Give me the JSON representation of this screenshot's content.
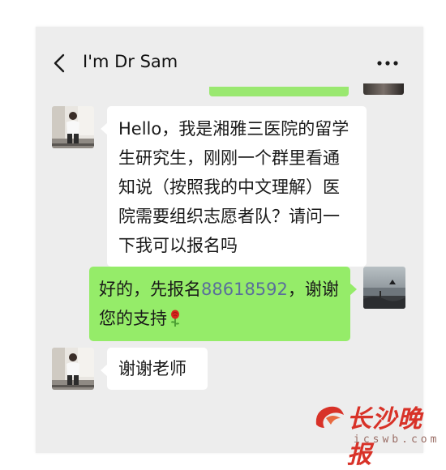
{
  "header": {
    "title": "I'm Dr Sam"
  },
  "icons": {
    "back": "chevron-left-icon",
    "more": "more-dots-icon",
    "rose": "rose-emoji"
  },
  "colors": {
    "chat_background": "#ededed",
    "incoming_bubble": "#ffffff",
    "outgoing_bubble": "#95ec69",
    "phone_link": "#5a6f9b",
    "watermark_red": "#d83228"
  },
  "messages": [
    {
      "direction": "incoming",
      "text": "Hello，我是湘雅三医院的留学生研究生，刚刚一个群里看通知说（按照我的中文理解）医院需要组织志愿者队？请问一下我可以报名吗"
    },
    {
      "direction": "outgoing",
      "text_before": "好的，先报名",
      "phone": "88618592",
      "text_after": "，谢谢您的支持"
    },
    {
      "direction": "incoming",
      "text": "谢谢老师"
    }
  ],
  "watermark": {
    "name": "长沙晚报",
    "url": "icswb.com"
  }
}
